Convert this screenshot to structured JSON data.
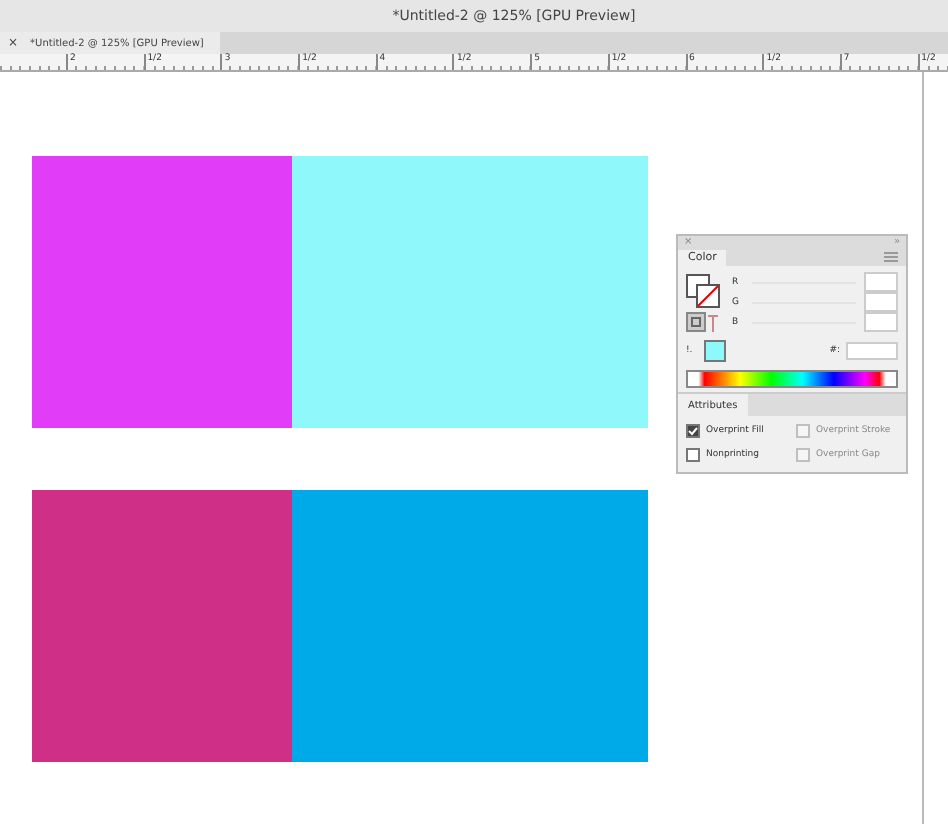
{
  "window": {
    "title": "*Untitled-2 @ 125% [GPU Preview]"
  },
  "tabs": [
    {
      "label": "*Untitled-2 @ 125% [GPU Preview]",
      "close": "×",
      "selected": true
    }
  ],
  "ruler": {
    "labels": [
      "2",
      "1/2",
      "3",
      "1/2",
      "4",
      "1/2",
      "5",
      "1/2",
      "6",
      "1/2",
      "7",
      "1/2"
    ]
  },
  "canvas": {
    "shapes": [
      {
        "color": "#e13cf7"
      },
      {
        "color": "#8ef8fb"
      },
      {
        "color": "#d02f88"
      },
      {
        "color": "#00a9e8"
      }
    ]
  },
  "color_panel": {
    "close": "×",
    "collapse": "»",
    "tab": "Color",
    "channels": [
      {
        "label": "R"
      },
      {
        "label": "G"
      },
      {
        "label": "B"
      }
    ],
    "warning": "!.",
    "hex_label": "#:",
    "attributes": {
      "tab": "Attributes",
      "options": [
        {
          "label": "Overprint Fill",
          "checked": true,
          "disabled": false
        },
        {
          "label": "Overprint Stroke",
          "checked": false,
          "disabled": true
        },
        {
          "label": "Nonprinting",
          "checked": false,
          "disabled": false
        },
        {
          "label": "Overprint Gap",
          "checked": false,
          "disabled": true
        }
      ]
    }
  }
}
